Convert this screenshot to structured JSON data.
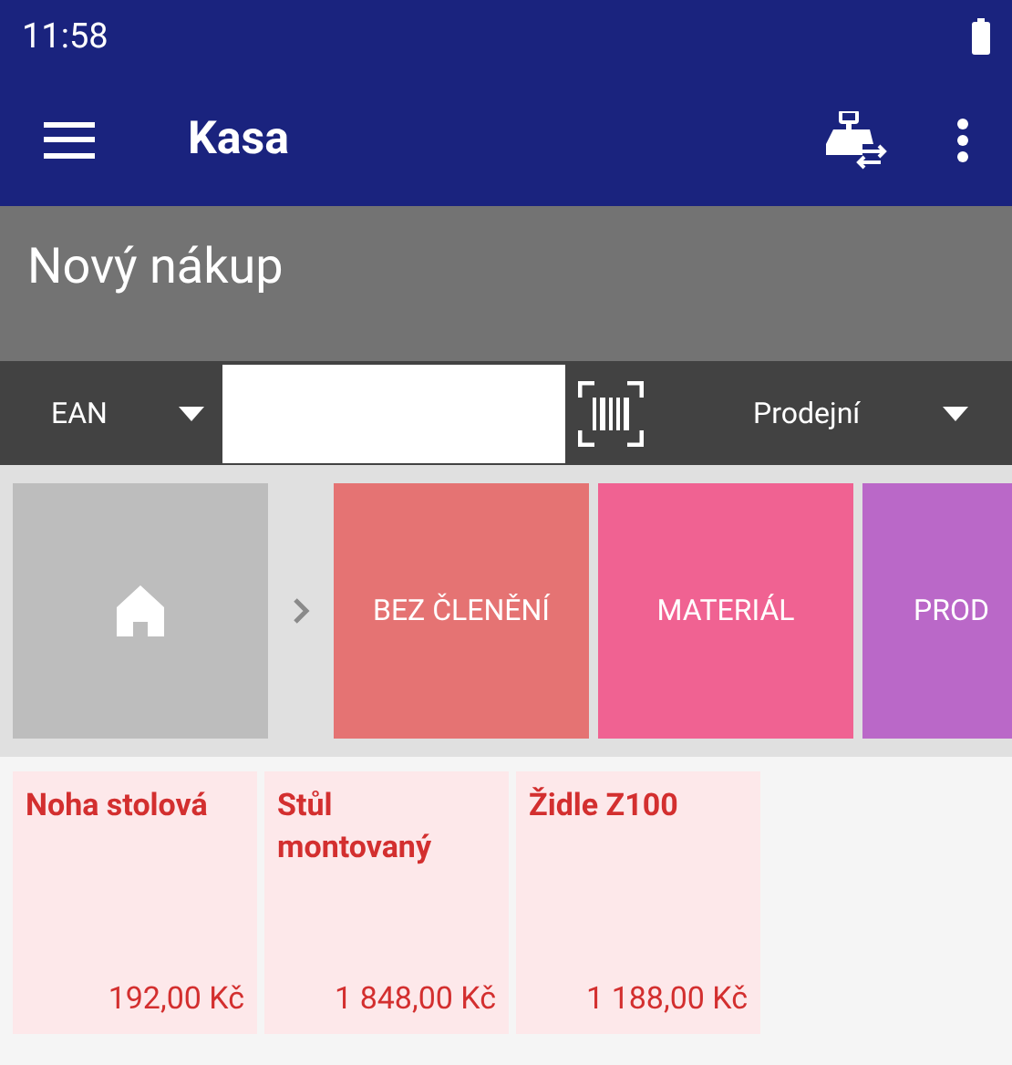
{
  "status_bar": {
    "time": "11:58"
  },
  "app_bar": {
    "title": "Kasa"
  },
  "header": {
    "title": "Nový nákup"
  },
  "toolbar": {
    "code_type": "EAN",
    "price_list": "Prodejní"
  },
  "categories": [
    {
      "label": "BEZ ČLENĚNÍ",
      "color": "#e57373"
    },
    {
      "label": "MATERIÁL",
      "color": "#f06292"
    },
    {
      "label": "PROD",
      "color": "#ba68c8"
    }
  ],
  "products": [
    {
      "name": "Noha stolová",
      "price": "192,00 Kč"
    },
    {
      "name": "Stůl montovaný",
      "price": "1 848,00 Kč"
    },
    {
      "name": "Židle Z100",
      "price": "1 188,00 Kč"
    }
  ]
}
